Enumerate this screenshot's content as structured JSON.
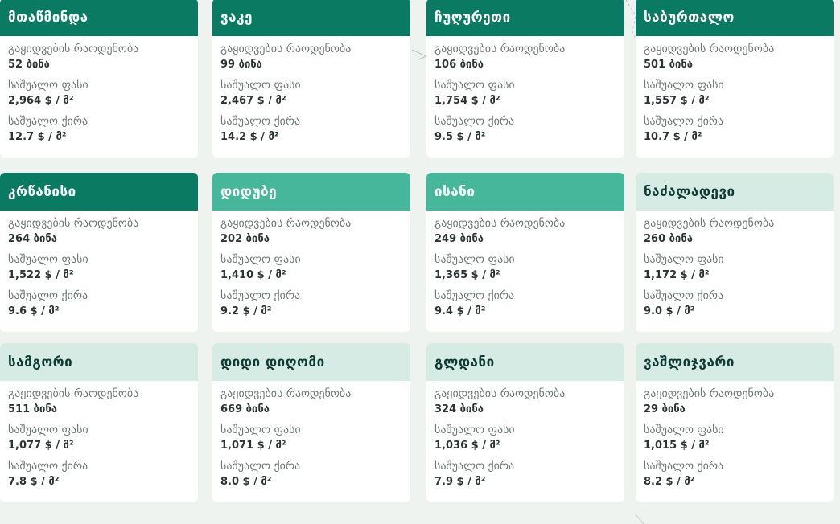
{
  "labels": {
    "listings": "გაყიდვების რაოდენობა",
    "avg_price": "საშუალო ფასი",
    "avg_rent": "საშუალო ქირა"
  },
  "colors": {
    "dark": "#0b7a62",
    "mid": "#47b79b",
    "light": "#d6ebe3",
    "background": "#eef3ef"
  },
  "districts": [
    {
      "name": "მთაწმინდა",
      "shade": "dark",
      "listings": "52 ბინა",
      "price": "2,964 $ / მ²",
      "rent": "12.7 $ / მ²"
    },
    {
      "name": "ვაკე",
      "shade": "dark",
      "listings": "99 ბინა",
      "price": "2,467 $ / მ²",
      "rent": "14.2 $ / მ²"
    },
    {
      "name": "ჩუღურეთი",
      "shade": "dark",
      "listings": "106 ბინა",
      "price": "1,754 $ / მ²",
      "rent": "9.5 $ / მ²"
    },
    {
      "name": "საბურთალო",
      "shade": "dark",
      "listings": "501 ბინა",
      "price": "1,557 $ / მ²",
      "rent": "10.7 $ / მ²"
    },
    {
      "name": "კრწანისი",
      "shade": "dark",
      "listings": "264 ბინა",
      "price": "1,522 $ / მ²",
      "rent": "9.6 $ / მ²"
    },
    {
      "name": "დიდუბე",
      "shade": "mid",
      "listings": "202 ბინა",
      "price": "1,410 $ / მ²",
      "rent": "9.2 $ / მ²"
    },
    {
      "name": "ისანი",
      "shade": "mid",
      "listings": "249 ბინა",
      "price": "1,365 $ / მ²",
      "rent": "9.4 $ / მ²"
    },
    {
      "name": "ნაძალადევი",
      "shade": "light",
      "listings": "260 ბინა",
      "price": "1,172 $ / მ²",
      "rent": "9.0 $ / მ²"
    },
    {
      "name": "სამგორი",
      "shade": "light",
      "listings": "511 ბინა",
      "price": "1,077 $ / მ²",
      "rent": "7.8 $ / მ²"
    },
    {
      "name": "დიდი დიღომი",
      "shade": "light",
      "listings": "669 ბინა",
      "price": "1,071 $ / მ²",
      "rent": "8.0 $ / მ²"
    },
    {
      "name": "გლდანი",
      "shade": "light",
      "listings": "324 ბინა",
      "price": "1,036 $ / მ²",
      "rent": "7.9 $ / მ²"
    },
    {
      "name": "ვაშლიჯვარი",
      "shade": "light",
      "listings": "29 ბინა",
      "price": "1,015 $ / მ²",
      "rent": "8.2 $ / მ²"
    }
  ]
}
